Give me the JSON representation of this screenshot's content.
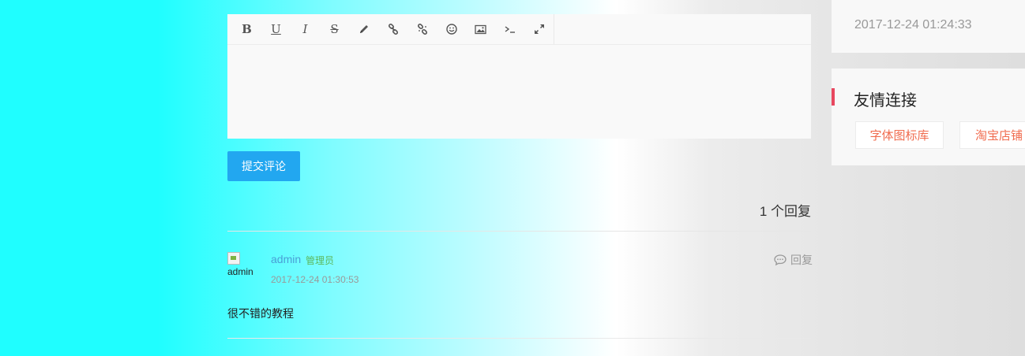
{
  "editor": {
    "toolbar": [
      {
        "name": "bold-button",
        "label": "B",
        "icon": "bold"
      },
      {
        "name": "underline-button",
        "label": "U",
        "icon": "underline"
      },
      {
        "name": "italic-button",
        "label": "I",
        "icon": "italic"
      },
      {
        "name": "strikethrough-button",
        "label": "S",
        "icon": "strikethrough"
      },
      {
        "name": "pencil-button",
        "icon": "pencil-icon"
      },
      {
        "name": "link-button",
        "icon": "link-icon"
      },
      {
        "name": "unlink-button",
        "icon": "unlink-icon"
      },
      {
        "name": "emoji-button",
        "icon": "smile-icon"
      },
      {
        "name": "image-button",
        "icon": "image-icon"
      },
      {
        "name": "code-button",
        "icon": "terminal-icon"
      },
      {
        "name": "fullscreen-button",
        "icon": "expand-icon"
      }
    ],
    "content": ""
  },
  "submit_label": "提交评论",
  "reply_count_text": "1 个回复",
  "comment": {
    "avatar_alt": "admin",
    "author": "admin",
    "badge": "管理员",
    "time": "2017-12-24 01:30:53",
    "reply_label": "回复",
    "body": "很不错的教程"
  },
  "sidebar": {
    "top_date": "2017-12-24 01:24:33",
    "links_title": "友情连接",
    "links": [
      "字体图标库",
      "淘宝店铺"
    ]
  },
  "colors": {
    "submit_bg": "#22a7f0",
    "author_link": "#4a9fd5",
    "badge": "#5cb85c",
    "link_tag_text": "#f06b4e",
    "title_bar": "#e8475f"
  }
}
